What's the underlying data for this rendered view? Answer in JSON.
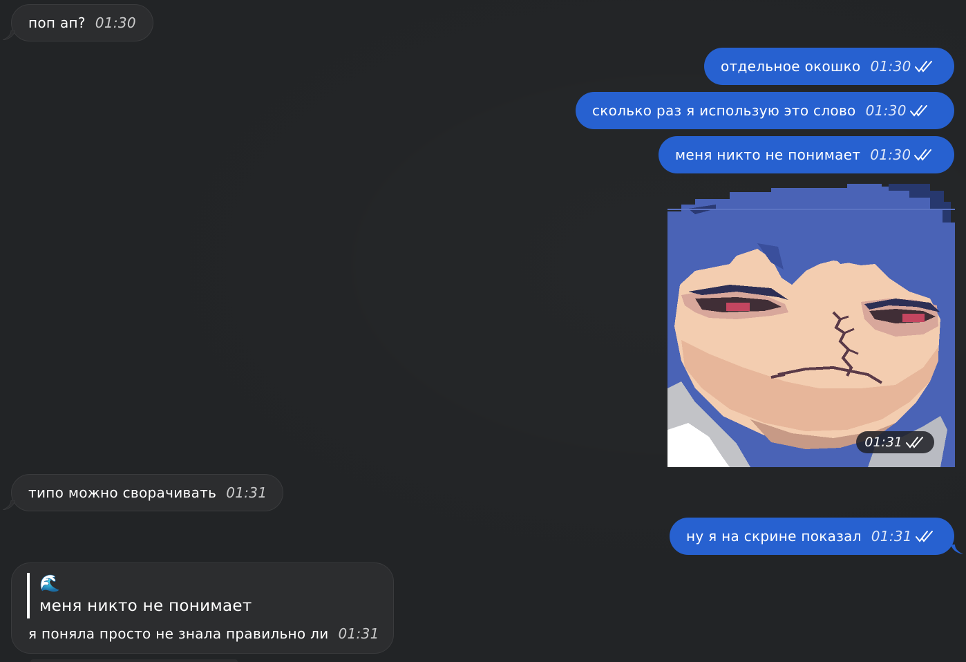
{
  "messages": [
    {
      "id": "m1",
      "dir": "in",
      "text": "поп ап?",
      "time": "01:30"
    },
    {
      "id": "m2",
      "dir": "out",
      "text": "отдельное окошко",
      "time": "01:30",
      "read": true
    },
    {
      "id": "m3",
      "dir": "out",
      "text": "сколько раз я использую это слово",
      "time": "01:30",
      "read": true
    },
    {
      "id": "m4",
      "dir": "out",
      "text": "меня никто не понимает",
      "time": "01:30",
      "read": true
    },
    {
      "id": "m5",
      "dir": "out",
      "type": "sticker",
      "time": "01:31",
      "read": true
    },
    {
      "id": "m6",
      "dir": "in",
      "text": "типо можно сворачивать",
      "time": "01:31"
    },
    {
      "id": "m7",
      "dir": "out",
      "text": "ну я на скрине показал",
      "time": "01:31",
      "read": true
    },
    {
      "id": "m8",
      "dir": "in",
      "text": "я поняла просто не знала правильно ли",
      "time": "01:31",
      "reply": {
        "emoji": "🌊",
        "text": "меня никто не понимает"
      }
    }
  ],
  "colors": {
    "background": "#222426",
    "incoming_bubble": "#2c2d2f",
    "outgoing_bubble": "#2761d0",
    "sticker_hair": "#4a63b6",
    "sticker_skin": "#f3cdb0"
  },
  "icons": {
    "read_receipt": "double-check-icon",
    "sticker": "pixel-art-anime-face-sticker",
    "quote_emoji": "wave-emoji"
  }
}
